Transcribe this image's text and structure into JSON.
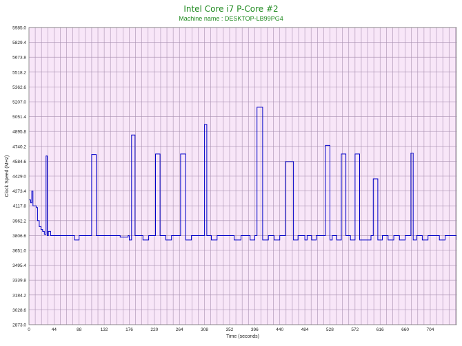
{
  "chart_data": {
    "type": "line",
    "title": "Intel Core i7 P-Core #2",
    "subtitle": "Machine name : DESKTOP-LB99PG4",
    "xlabel": "Time (seconds)",
    "ylabel": "Clock Speed (MHz)",
    "xlim": [
      0,
      750
    ],
    "ylim": [
      2873.0,
      5985.0
    ],
    "x_ticks": [
      0,
      44,
      88,
      132,
      176,
      220,
      264,
      308,
      352,
      396,
      440,
      484,
      528,
      572,
      616,
      660,
      704
    ],
    "y_ticks": [
      2873.0,
      3028.6,
      3184.2,
      3339.8,
      3495.4,
      3651.0,
      3806.6,
      3962.2,
      4117.8,
      4273.4,
      4429.0,
      4584.6,
      4740.2,
      4895.8,
      5051.4,
      5207.0,
      5362.6,
      5518.2,
      5673.8,
      5829.4,
      5985.0
    ],
    "grid": true,
    "colors": {
      "line": "#0000c8",
      "plot_bg": "#f8e6f8",
      "grid": "#a890b0",
      "title": "#1f8a1f"
    },
    "series": [
      {
        "x": [
          0,
          3,
          5,
          7,
          9,
          11,
          13,
          15,
          18,
          21,
          24,
          27,
          30,
          32,
          34,
          38,
          44,
          52,
          60,
          70,
          80,
          88,
          95,
          104,
          110,
          118,
          132,
          145,
          160,
          174,
          176,
          180,
          186,
          194,
          200,
          210,
          220,
          222,
          230,
          240,
          250,
          264,
          266,
          275,
          285,
          300,
          308,
          312,
          320,
          330,
          340,
          352,
          360,
          372,
          380,
          388,
          396,
          400,
          410,
          420,
          430,
          440,
          450,
          464,
          472,
          484,
          488,
          496,
          504,
          512,
          520,
          528,
          532,
          540,
          548,
          556,
          564,
          572,
          580,
          590,
          600,
          604,
          612,
          620,
          630,
          640,
          650,
          660,
          670,
          674,
          680,
          690,
          700,
          712,
          720,
          730,
          740,
          750
        ],
        "y": [
          4180,
          4150,
          4273,
          4117,
          4117,
          4117,
          4100,
          3962,
          3900,
          3870,
          3850,
          3820,
          4640,
          3806,
          3850,
          3806,
          3806,
          3806,
          3806,
          3806,
          3760,
          3806,
          3806,
          3806,
          4655,
          3806,
          3806,
          3806,
          3790,
          3806,
          3760,
          4860,
          3806,
          3806,
          3760,
          3806,
          3806,
          4660,
          3806,
          3760,
          3806,
          3806,
          4660,
          3760,
          3806,
          3806,
          4970,
          3806,
          3760,
          3806,
          3806,
          3806,
          3760,
          3806,
          3806,
          3760,
          3806,
          5150,
          3760,
          3806,
          3760,
          3806,
          4580,
          3760,
          3806,
          3760,
          3806,
          3760,
          3806,
          3806,
          4750,
          3760,
          3806,
          3760,
          4660,
          3806,
          3760,
          4660,
          3760,
          3760,
          3806,
          4400,
          3760,
          3806,
          3760,
          3806,
          3760,
          3806,
          4670,
          3760,
          3806,
          3760,
          3806,
          3806,
          3760,
          3806,
          3806,
          3760
        ]
      }
    ]
  }
}
